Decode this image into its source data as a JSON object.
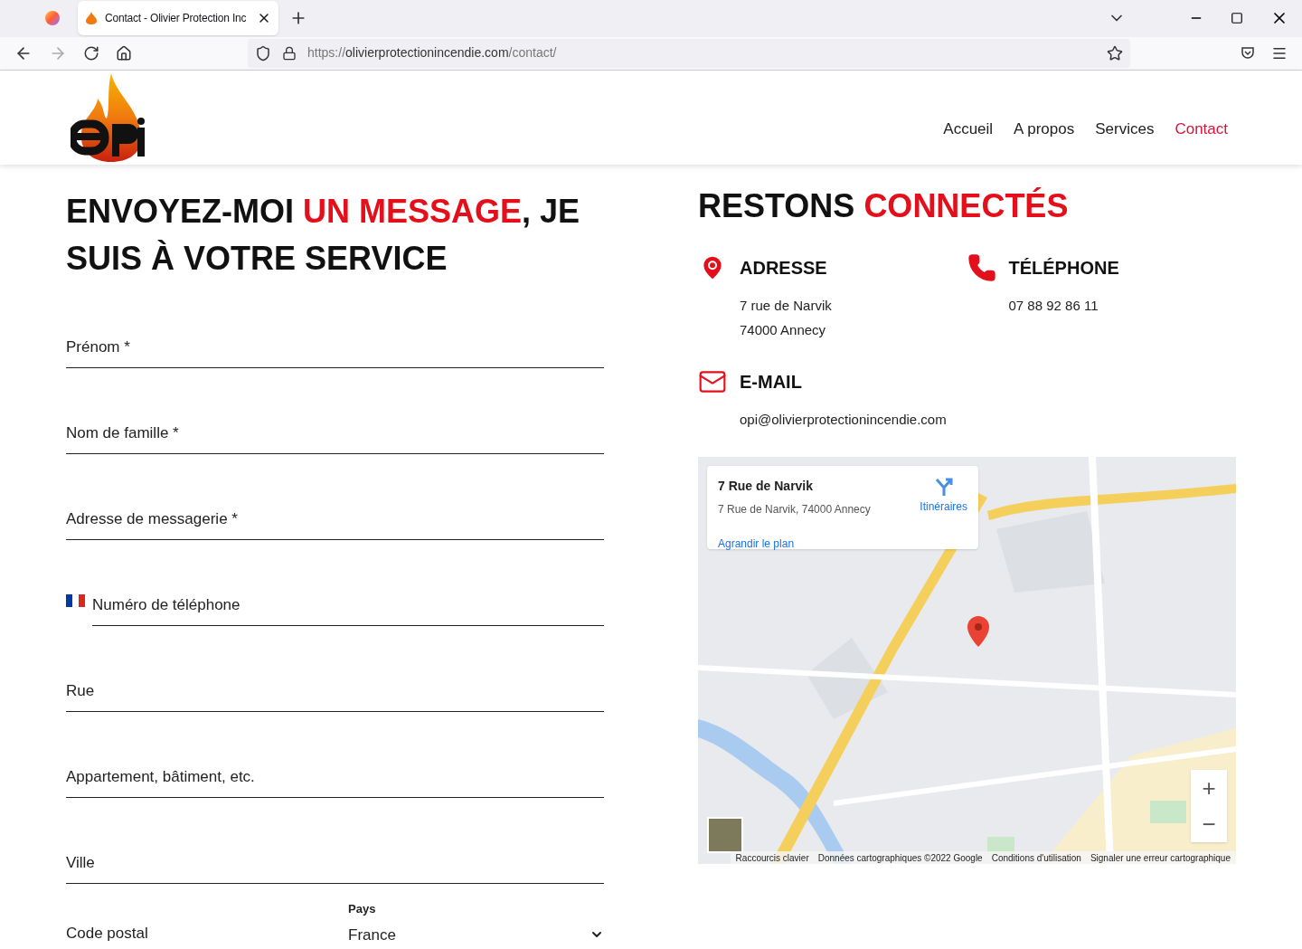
{
  "browser": {
    "tabs": [
      {
        "title": "Contact - Olivier Protection Inc",
        "selected": true
      }
    ],
    "url": {
      "scheme": "https://",
      "host": "olivierprotectionincendie.com",
      "path": "/contact/"
    }
  },
  "nav": [
    {
      "label": "Accueil",
      "selected": false
    },
    {
      "label": "A propos",
      "selected": false
    },
    {
      "label": "Services",
      "selected": false
    },
    {
      "label": "Contact",
      "selected": true
    }
  ],
  "form": {
    "heading": [
      {
        "text": "ENVOYEZ-MOI ",
        "accent": false
      },
      {
        "text": "UN MESSAGE",
        "accent": true
      },
      {
        "text": ", JE SUIS À VOTRE SERVICE",
        "accent": false
      }
    ],
    "fields": [
      {
        "kind": "text",
        "placeholder": "Prénom *"
      },
      {
        "kind": "text",
        "placeholder": "Nom de famille *"
      },
      {
        "kind": "text",
        "placeholder": "Adresse de messagerie *"
      },
      {
        "kind": "phone",
        "placeholder": "Numéro de téléphone"
      },
      {
        "kind": "text",
        "placeholder": "Rue"
      },
      {
        "kind": "text",
        "placeholder": "Appartement, bâtiment, etc."
      },
      {
        "kind": "text",
        "placeholder": "Ville"
      }
    ],
    "postal": {
      "placeholder": "Code postal"
    },
    "country": {
      "label": "Pays",
      "value": "France"
    }
  },
  "contact": {
    "heading": [
      {
        "text": "RESTONS ",
        "accent": false
      },
      {
        "text": "CONNECTÉS",
        "accent": true
      }
    ],
    "blocks": [
      {
        "kind": "address",
        "title": "ADRESSE",
        "lines": [
          "7 rue de Narvik",
          "74000 Annecy"
        ]
      },
      {
        "kind": "phone",
        "title": "TÉLÉPHONE",
        "lines": [
          "07 88 92 86 11"
        ]
      },
      {
        "kind": "email",
        "title": "E-MAIL",
        "lines": [
          "opi@olivierprotectionincendie.com"
        ]
      }
    ]
  },
  "map": {
    "kind": "picture",
    "card": {
      "title": "7 Rue de Narvik",
      "address": "7 Rue de Narvik, 74000 Annecy",
      "directions": "Itinéraires",
      "enlarge": "Agrandir le plan"
    },
    "zoom": {
      "in": "+",
      "out": "−"
    },
    "footer": [
      "Raccourcis clavier",
      "Données cartographiques ©2022 Google",
      "Conditions d'utilisation",
      "Signaler une erreur cartographique"
    ]
  }
}
